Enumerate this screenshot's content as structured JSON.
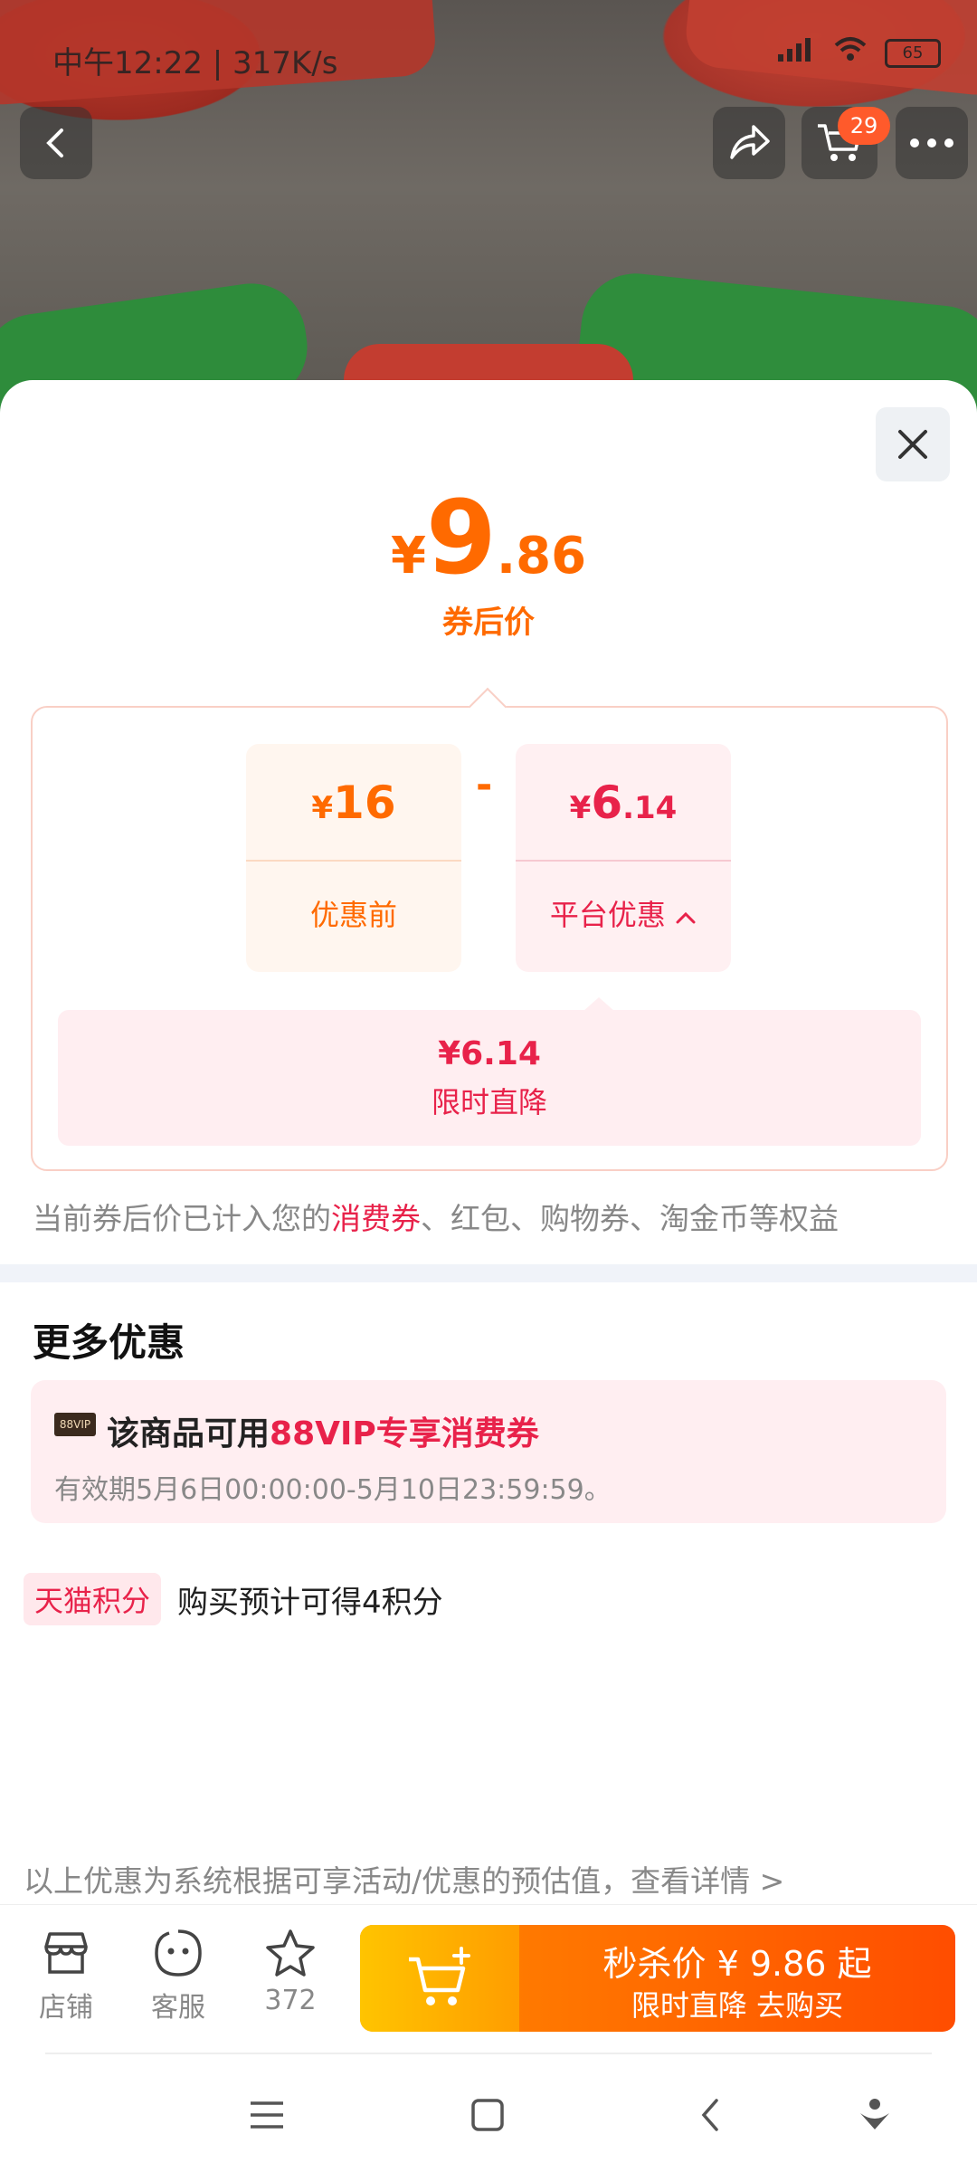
{
  "status_bar": {
    "time": "中午12:22 | 317K/s",
    "battery": "65"
  },
  "header": {
    "cart_count": "29"
  },
  "price": {
    "currency": "¥",
    "integer": "9",
    "decimal": ".86",
    "label": "券后价"
  },
  "breakdown": {
    "before": {
      "currency": "¥",
      "integer": "16",
      "decimal": "",
      "label": "优惠前"
    },
    "operator": "-",
    "platform": {
      "currency": "¥",
      "integer": "6",
      "decimal": ".14",
      "label": "平台优惠"
    },
    "detail": {
      "value": "¥6.14",
      "label": "限时直降"
    }
  },
  "note": {
    "prefix": "当前券后价已计入您的",
    "highlight": "消费券",
    "suffix": "、红包、购物券、淘金币等权益"
  },
  "more": {
    "title": "更多优惠",
    "vip": {
      "badge": "88VIP",
      "line_prefix": "该商品可用",
      "line_highlight": "88VIP专享消费券",
      "validity": "有效期5月6日00:00:00-5月10日23:59:59。"
    },
    "points": {
      "tag": "天猫积分",
      "text": "购买预计可得4积分"
    }
  },
  "footer_note": "以上优惠为系统根据可享活动/优惠的预估值，查看详情 >",
  "bottom_bar": {
    "store": "店铺",
    "service": "客服",
    "favorite_count": "372",
    "cta_line1": "秒杀价 ¥ 9.86 起",
    "cta_line2": "限时直降  去购买"
  },
  "colors": {
    "orange": "#ff6a00",
    "red": "#e8224a"
  }
}
